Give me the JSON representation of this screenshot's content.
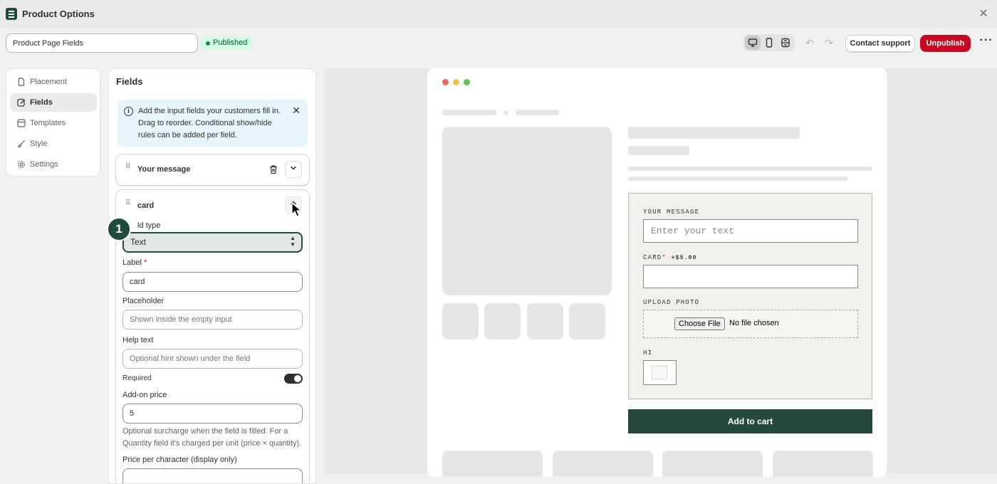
{
  "window": {
    "title": "Product Options",
    "close_icon": "close-icon"
  },
  "toolbar": {
    "name_value": "Product Page Fields",
    "status": "Published",
    "devices": [
      "desktop-icon",
      "mobile-icon",
      "fullwidth-icon"
    ],
    "selected_device": "desktop",
    "contact_label": "Contact support",
    "unpublish_label": "Unpublish",
    "more_label": "···"
  },
  "sidebar": {
    "items": [
      {
        "label": "Placement",
        "icon": "page-icon",
        "active": false
      },
      {
        "label": "Fields",
        "icon": "edit-icon",
        "active": true
      },
      {
        "label": "Templates",
        "icon": "template-icon",
        "active": false
      },
      {
        "label": "Style",
        "icon": "brush-icon",
        "active": false
      },
      {
        "label": "Settings",
        "icon": "gear-icon",
        "active": false
      }
    ]
  },
  "fields_panel": {
    "heading": "Fields",
    "info": {
      "line1": "Add the input fields your customers fill in.",
      "line2": "Drag to reorder. Conditional show/hide",
      "line3": "rules can be added per field."
    },
    "collapsed_field": {
      "name": "Your message"
    },
    "open_field": {
      "name": "card",
      "type_label": "ld type",
      "type_value": "Text",
      "label_label": "Label",
      "label_required_mark": "*",
      "label_value": "card",
      "placeholder_label": "Placeholder",
      "placeholder_hint": "Shown inside the empty input",
      "help_label": "Help text",
      "help_hint": "Optional hint shown under the field",
      "required_label": "Required",
      "required_on": true,
      "addon_label": "Add-on price",
      "addon_value": "5",
      "addon_note_1": "Optional surcharge when the field is filled. For a",
      "addon_note_2": "Quantity field it's charged per unit (price × quantity).",
      "ppc_label": "Price per character (display only)"
    },
    "step_badge": "1"
  },
  "preview": {
    "dots": [
      "#ec6a5e",
      "#f4bf4f",
      "#61c554"
    ],
    "form": {
      "message_label": "YOUR MESSAGE",
      "message_placeholder": "Enter your text",
      "card_label": "CARD",
      "card_required": "*",
      "card_price": "+$5.00",
      "upload_label": "UPLOAD PHOTO",
      "choose_file": "Choose File",
      "no_file": "No file chosen",
      "hi_label": "HI"
    },
    "add_to_cart": "Add to cart"
  }
}
